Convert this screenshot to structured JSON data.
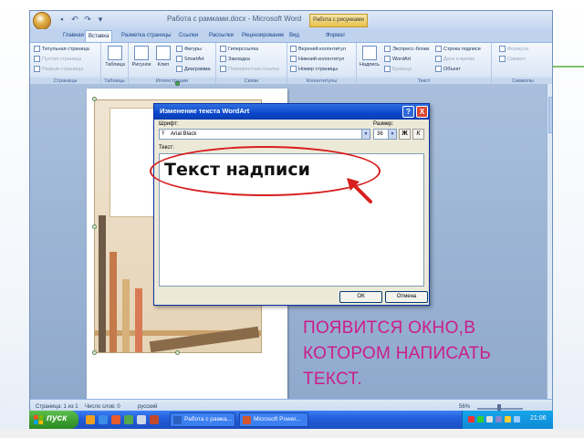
{
  "word": {
    "title": "Работа с рамками.docx - Microsoft Word",
    "contextual_tab": "Работа с рисунками",
    "tabs": [
      "Главная",
      "Вставка",
      "Разметка страницы",
      "Ссылки",
      "Рассылки",
      "Рецензирование",
      "Вид",
      "Формат"
    ],
    "active_tab": "Вставка",
    "ribbon": {
      "pages": {
        "label": "Страницы",
        "items": [
          "Титульная страница",
          "Пустая страница",
          "Разрыв страницы"
        ]
      },
      "tables": {
        "label": "Таблицы",
        "button": "Таблица"
      },
      "illustrations": {
        "label": "Иллюстрации",
        "big": [
          "Рисунок",
          "Клип"
        ],
        "items": [
          "Фигуры",
          "SmartArt",
          "Диаграмма"
        ]
      },
      "links": {
        "label": "Связи",
        "items": [
          "Гиперссылка",
          "Закладка",
          "Перекрестная ссылка"
        ]
      },
      "headers": {
        "label": "Колонтитулы",
        "items": [
          "Верхний колонтитул",
          "Нижний колонтитул",
          "Номер страницы"
        ]
      },
      "text": {
        "label": "Текст",
        "big": "Надпись",
        "items": [
          "Экспресс-блоки",
          "WordArt",
          "Буквица"
        ],
        "items2": [
          "Строка подписи",
          "Дата и время",
          "Объект"
        ]
      },
      "symbols": {
        "label": "Символы",
        "items": [
          "Формула",
          "Символ"
        ]
      }
    },
    "status": {
      "page": "Страница: 1 из 1",
      "words": "Число слов: 0",
      "language": "русский",
      "zoom": "56%"
    }
  },
  "dialog": {
    "title": "Изменение текста WordArt",
    "font_label": "Шрифт:",
    "font_value": "Arial Black",
    "size_label": "Размер:",
    "size_value": "36",
    "bold_label": "Ж",
    "italic_label": "К",
    "text_label": "Текст:",
    "text_value": "Текст надписи",
    "ok": "ОК",
    "cancel": "Отмена",
    "help": "?",
    "close": "X"
  },
  "caption": {
    "lines": [
      "ПОЯВИТСЯ ОКНО,В",
      "КОТОРОМ НАПИСАТЬ",
      "ТЕКСТ."
    ],
    "color": "#cc1d8a"
  },
  "annotation": {
    "color": "#d81e1e"
  },
  "taskbar": {
    "start": "пуск",
    "buttons": [
      "Работа с рамка...",
      "Microsoft Power..."
    ],
    "clock": "21:06"
  },
  "colors": {
    "xp_blue": "#245edb",
    "start_green": "#3a9b2f",
    "ribbon_blue": "#bfd3ee"
  }
}
